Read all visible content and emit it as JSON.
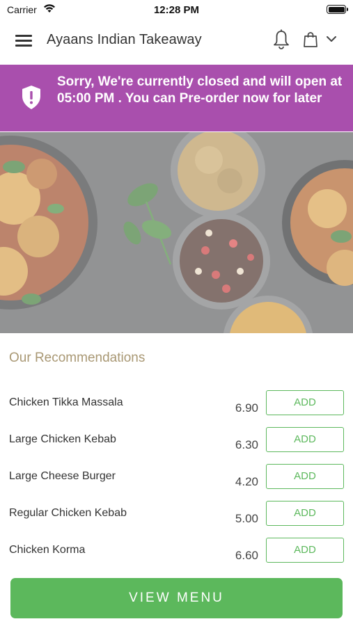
{
  "status_bar": {
    "carrier": "Carrier",
    "time": "12:28 PM"
  },
  "header": {
    "title": "Ayaans Indian Takeaway"
  },
  "banner": {
    "message": "Sorry, We're currently closed and will open at 05:00 PM . You can Pre-order now for later",
    "color": "#a94fad"
  },
  "recommendations": {
    "title": "Our Recommendations",
    "items": [
      {
        "name": "Chicken Tikka Massala",
        "price": "6.90",
        "add_label": "ADD"
      },
      {
        "name": "Large Chicken Kebab",
        "price": "6.30",
        "add_label": "ADD"
      },
      {
        "name": "Large Cheese Burger",
        "price": "4.20",
        "add_label": "ADD"
      },
      {
        "name": "Regular Chicken Kebab",
        "price": "5.00",
        "add_label": "ADD"
      },
      {
        "name": "Chicken Korma",
        "price": "6.60",
        "add_label": "ADD"
      }
    ]
  },
  "footer": {
    "view_menu_label": "VIEW MENU"
  },
  "colors": {
    "accent_green": "#5cb85c",
    "banner_purple": "#a94fad",
    "section_title": "#a99874"
  },
  "icons": [
    "wifi-icon",
    "battery-icon",
    "menu-icon",
    "bell-icon",
    "shopping-bag-icon",
    "chevron-down-icon",
    "shield-icon"
  ]
}
